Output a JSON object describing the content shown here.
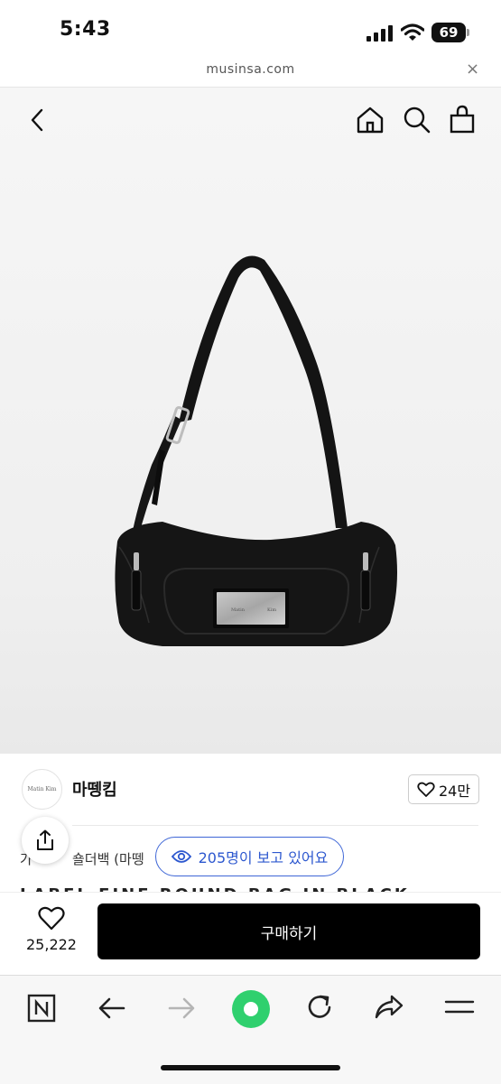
{
  "status_bar": {
    "time": "5:43",
    "battery": "69"
  },
  "browser": {
    "url": "musinsa.com",
    "close_label": "×"
  },
  "header_icons": [
    "back-icon",
    "home-icon",
    "search-icon",
    "shopping-bag-icon"
  ],
  "product": {
    "image_icon": "black-shoulder-bag-image",
    "plate_text_left": "Matin",
    "plate_text_right": "Kim"
  },
  "brand": {
    "logo_text": "Matin Kim",
    "name": "마뗑킴",
    "likes": "24만"
  },
  "category": {
    "prefix": "가",
    "text": "숄더백 (마뗑"
  },
  "viewers": {
    "text": "205명이 보고 있어요"
  },
  "title_peek": "LABEL FINE ROUND BAG IN BLACK",
  "purchase": {
    "wish_count": "25,222",
    "buy_label": "구매하기"
  },
  "toolbar_icons": [
    "naver-n-icon",
    "back-arrow-icon",
    "forward-arrow-icon",
    "green-dot-icon",
    "refresh-icon",
    "share-icon",
    "menu-icon"
  ],
  "colors": {
    "accent_blue": "#2d58cf",
    "green_button": "#2fd06e",
    "buy_button": "#000000"
  }
}
